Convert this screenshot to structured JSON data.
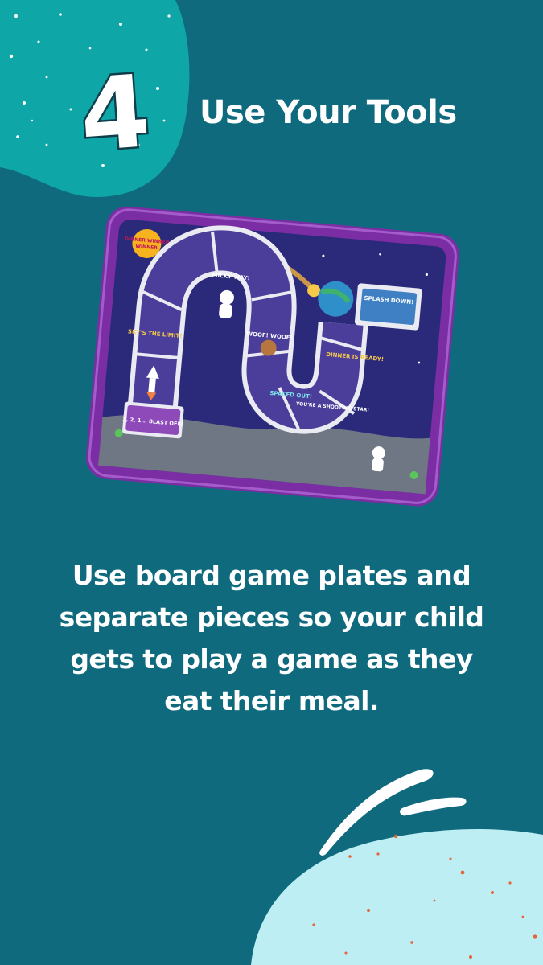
{
  "step": {
    "number": "4",
    "title": "Use Your Tools"
  },
  "image": {
    "alt": "Space-themed board game dinner plate",
    "labels": {
      "start": "3, 2, 1... BLAST OFF!",
      "sky": "SKY'S THE LIMIT!",
      "milky": "MILKY WAY!",
      "woof": "WOOF! WOOF!",
      "spaced": "SPACED OUT!",
      "shooting": "YOU'RE A SHOOTING STAR!",
      "dinner": "DINNER IS READY!",
      "finish": "SPLASH DOWN!",
      "badge": "DINNER WINNER"
    }
  },
  "body": {
    "text": "Use board game plates and separate pieces so your child gets to play a game as they eat their meal."
  },
  "colors": {
    "background": "#106a7e",
    "top_blob": "#0fa6a8",
    "bottom_blob": "#bdeef4",
    "plate_rim": "#7b2ea3",
    "plate_board": "#2b2a7a",
    "text": "#ffffff",
    "confetti": "#e8623a"
  },
  "icons": [
    "sparkle-dots",
    "swoosh-lines",
    "confetti-dots",
    "rocket-icon",
    "astronaut-icon",
    "planet-icon"
  ]
}
